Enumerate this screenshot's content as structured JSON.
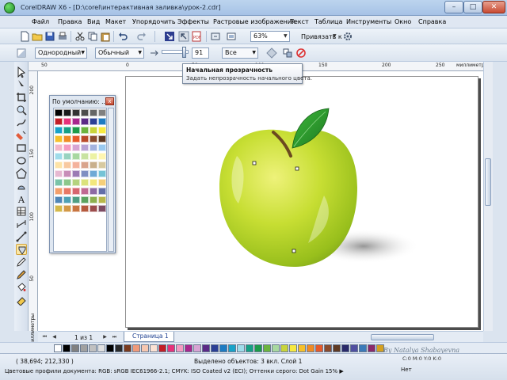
{
  "window": {
    "title": "CorelDRAW X6 - [D:\\corel\\интерактивная заливка\\урок-2.cdr]",
    "minimize_label": "–",
    "maximize_label": "□",
    "close_label": "✕"
  },
  "menu": {
    "items": [
      "Файл",
      "Правка",
      "Вид",
      "Макет",
      "Упорядочить",
      "Эффекты",
      "Растровые изображения",
      "Текст",
      "Таблица",
      "Инструменты",
      "Окно",
      "Справка"
    ]
  },
  "toolbar": {
    "zoom_value": "63%",
    "snap_label": "Привязать к"
  },
  "property_bar": {
    "transparency_type": "Однородный",
    "merge_mode": "Обычный",
    "opacity_value": "91",
    "opacity_fraction": 0.91,
    "apply_target": "Все"
  },
  "tooltip": {
    "title": "Начальная прозрачность",
    "description": "Задать непрозрачность начального цвета."
  },
  "rulers": {
    "h_labels": [
      "50",
      "0",
      "50",
      "100",
      "150",
      "200",
      "250"
    ],
    "h_units": "миллиметры",
    "v_labels": [
      "200",
      "150",
      "100",
      "50"
    ],
    "v_units": "миллиметры"
  },
  "palette_docker": {
    "title": "По умолчанию: ...",
    "close_label": "x",
    "colors": [
      "#000000",
      "#1a1a1a",
      "#333333",
      "#4d4d4d",
      "#666666",
      "#808080",
      "#c21e26",
      "#e6327a",
      "#a8278d",
      "#5b2a86",
      "#2b3f95",
      "#1d7bc2",
      "#18a2c8",
      "#16a085",
      "#1d9b4a",
      "#6cb43f",
      "#c9d43b",
      "#f7e940",
      "#f6c02a",
      "#ef8b25",
      "#e55a2b",
      "#b94a2a",
      "#8a4b2d",
      "#5f3a23",
      "#f3b6c8",
      "#f49ac1",
      "#d7a4d3",
      "#b8a3d4",
      "#a3b3df",
      "#99c9ef",
      "#9fdcea",
      "#98d3c0",
      "#a8d8a0",
      "#c8e3a1",
      "#ecf2a3",
      "#fff6b0",
      "#fde3a6",
      "#f8c9a0",
      "#f4b29c",
      "#d9a48c",
      "#c9b08c",
      "#d7c9a0",
      "#e6b8d1",
      "#c88db8",
      "#9b7bb4",
      "#7f8fc2",
      "#6fa9d6",
      "#75c3d6",
      "#79c3a8",
      "#8cc78a",
      "#b5d37f",
      "#dbe27c",
      "#f2e77d",
      "#f5cf7a",
      "#f29f6b",
      "#e87966",
      "#d6666f",
      "#c06a92",
      "#8d6aa3",
      "#636fa8",
      "#4f86b7",
      "#4ea1b5",
      "#4f9e83",
      "#5ca35f",
      "#8db04f",
      "#b7b74a",
      "#d4b94a",
      "#d39947",
      "#c87541",
      "#b55a3e",
      "#9c4d4c",
      "#7d4c63"
    ]
  },
  "page_nav": {
    "count": "1 из 1",
    "tab_label": "Страница 1"
  },
  "color_strip": [
    "#ffffff",
    "#000000",
    "#808080",
    "#a0a0a0",
    "#c0c0c0",
    "#e0e0e0",
    "#000000",
    "#2b2b2b",
    "#7a3b1f",
    "#ef9a7a",
    "#f6c7b0",
    "#fbe2d3",
    "#c21e26",
    "#e6327a",
    "#f49ac1",
    "#a8278d",
    "#d7a4d3",
    "#5b2a86",
    "#2b3f95",
    "#1d7bc2",
    "#18a2c8",
    "#9fdcea",
    "#16a085",
    "#1d9b4a",
    "#6cb43f",
    "#a8d8a0",
    "#c9d43b",
    "#f7e940",
    "#f6c02a",
    "#ef8b25",
    "#e55a2b",
    "#8a4b2d",
    "#5f3a23",
    "#2a2a6a",
    "#4f4fa0",
    "#3a7ab8",
    "#8a2a6a",
    "#d4a020",
    "#20a0a0",
    "#3aa03a",
    "#7ac03a",
    "#e0e040"
  ],
  "status": {
    "coords": "( 38,694; 212,330 )",
    "selected": "Выделено объектов: 3 вкл. Слой 1",
    "profiles": "Цветовые профили документа: RGB: sRGB IEC61966-2.1; CMYK: ISO Coated v2 (ECI); Оттенки серого: Dot Gain 15% ▶",
    "fill_info": "C:0 M:0 Y:0 K:0",
    "outline_info": "Нет",
    "watermark": "By Natalya Shabayevna"
  },
  "colors": {
    "apple_light": "#e8f07a",
    "apple_mid": "#b7d42a",
    "apple_dark": "#7ea31a",
    "leaf": "#2e9b2f",
    "stem": "#6b4a1f"
  }
}
